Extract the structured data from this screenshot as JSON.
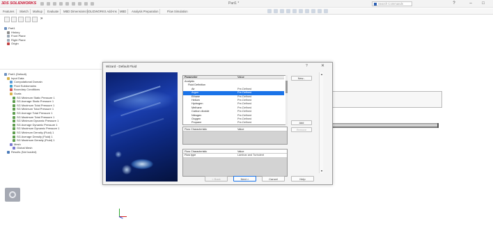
{
  "app": {
    "logo_text": "3DS SOLIDWORKS",
    "document_title": "Part1 *",
    "search_placeholder": "Search Commands",
    "window_controls": [
      "?",
      "–",
      "□"
    ]
  },
  "tabs": [
    "Features",
    "Sketch",
    "Markup",
    "Evaluate",
    "MBD Dimensions",
    "SOLIDWORKS Add-Ins",
    "MBD",
    "Analysis Preparation",
    "Flow Simulation"
  ],
  "feature_manager": {
    "tab_icons": [
      "feature-tree-icon",
      "property-manager-icon",
      "config-manager-icon",
      "dimxpert-icon",
      "display-manager-icon",
      "expand-icon"
    ],
    "top_tree": [
      {
        "label": "Part1",
        "level": 0,
        "icon": "part-icon"
      },
      {
        "label": "History",
        "level": 1,
        "icon": "history-icon"
      },
      {
        "label": "Front Plane",
        "level": 1,
        "icon": "plane-icon"
      },
      {
        "label": "Right Plane",
        "level": 1,
        "icon": "plane-icon"
      },
      {
        "label": "Origin",
        "level": 1,
        "icon": "origin-icon"
      }
    ],
    "flow_tree": [
      {
        "label": "Part1 (Default)",
        "level": 0,
        "icon": "part-icon"
      },
      {
        "label": "Input Data",
        "level": 1,
        "icon": "folder-icon"
      },
      {
        "label": "Computational Domain",
        "level": 2,
        "icon": "domain-icon"
      },
      {
        "label": "Fluid Subdomains",
        "level": 2,
        "icon": "fluid-icon"
      },
      {
        "label": "Boundary Conditions",
        "level": 2,
        "icon": "boundary-icon"
      },
      {
        "label": "Goals",
        "level": 2,
        "icon": "folder-icon"
      },
      {
        "label": "SG Minimum Static Pressure 1",
        "level": 3,
        "icon": "goal-icon"
      },
      {
        "label": "SG Average Static Pressure 1",
        "level": 3,
        "icon": "goal-icon"
      },
      {
        "label": "SG Maximum Total Pressure 1",
        "level": 3,
        "icon": "goal-icon"
      },
      {
        "label": "SG Minimum Total Pressure 1",
        "level": 3,
        "icon": "goal-icon"
      },
      {
        "label": "SG Average Total Pressure 1",
        "level": 3,
        "icon": "goal-icon"
      },
      {
        "label": "SG Maximum Total Pressure 1",
        "level": 3,
        "icon": "goal-icon"
      },
      {
        "label": "SG Minimum Dynamic Pressure 1",
        "level": 3,
        "icon": "goal-icon"
      },
      {
        "label": "SG Average Dynamic Pressure 1",
        "level": 3,
        "icon": "goal-icon"
      },
      {
        "label": "SG Maximum Dynamic Pressure 1",
        "level": 3,
        "icon": "goal-icon"
      },
      {
        "label": "SG Minimum Density (Fluid) 1",
        "level": 3,
        "icon": "goal-icon"
      },
      {
        "label": "SG Average Density (Fluid) 1",
        "level": 3,
        "icon": "goal-icon"
      },
      {
        "label": "SG Maximum Density (Fluid) 1",
        "level": 3,
        "icon": "goal-icon"
      },
      {
        "label": "Mesh",
        "level": 2,
        "icon": "mesh-icon"
      },
      {
        "label": "Global Mesh",
        "level": 3,
        "icon": "mesh-icon"
      },
      {
        "label": "Results (Not loaded)",
        "level": 1,
        "icon": "results-icon"
      }
    ]
  },
  "dialog": {
    "title": "Wizard - Default Fluid",
    "help_label": "?",
    "close_label": "✕",
    "props_header": {
      "col1": "Parameter",
      "col2": "Value"
    },
    "props_rows": [
      {
        "name": "Analysis",
        "value": "",
        "indent": 0,
        "selected": false
      },
      {
        "name": "Fluid Definition",
        "value": "",
        "indent": 1,
        "selected": false
      },
      {
        "name": "Air",
        "value": "Pre-Defined",
        "indent": 2,
        "selected": false
      },
      {
        "name": "Argon",
        "value": "Pre-Defined",
        "indent": 2,
        "selected": true
      },
      {
        "name": "Ethane",
        "value": "Pre-Defined",
        "indent": 2,
        "selected": false
      },
      {
        "name": "Helium",
        "value": "Pre-Defined",
        "indent": 2,
        "selected": false
      },
      {
        "name": "Hydrogen",
        "value": "Pre-Defined",
        "indent": 2,
        "selected": false
      },
      {
        "name": "Methane",
        "value": "Pre-Defined",
        "indent": 2,
        "selected": false
      },
      {
        "name": "Carbon dioxide",
        "value": "Pre-Defined",
        "indent": 2,
        "selected": false
      },
      {
        "name": "Nitrogen",
        "value": "Pre-Defined",
        "indent": 2,
        "selected": false
      },
      {
        "name": "Oxygen",
        "value": "Pre-Defined",
        "indent": 2,
        "selected": false
      },
      {
        "name": "Propane",
        "value": "Pre-Defined",
        "indent": 2,
        "selected": false
      },
      {
        "name": "Steam",
        "value": "Pre-Defined",
        "indent": 2,
        "selected": false
      }
    ],
    "effects_header": {
      "col1": "Flow Characteristic",
      "col2": "Value"
    },
    "disp_header": {
      "col1": "Flow Characteristic",
      "col2": "Value"
    },
    "disp_row": {
      "col1": "Flow type",
      "col2": "Laminar and Turbulent"
    },
    "side_buttons": {
      "new": "New...",
      "add": "Add",
      "remove": "Remove"
    },
    "footer_buttons": {
      "back": "< Back",
      "next": "Next >",
      "cancel": "Cancel",
      "help": "Help"
    }
  }
}
